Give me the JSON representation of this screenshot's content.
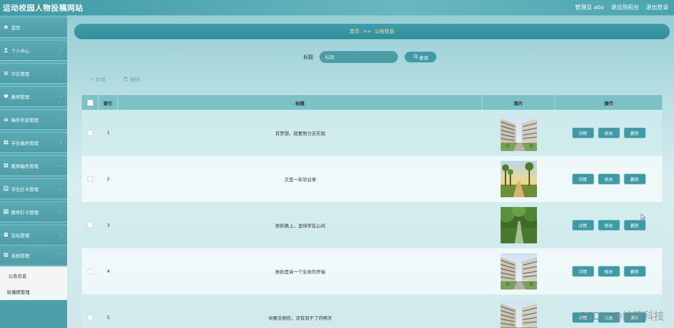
{
  "header": {
    "site_title": "运动校园人物投稿网站",
    "user_label": "管理员 abo",
    "link_front": "退出到前台",
    "link_logout": "退出登录"
  },
  "sidebar": {
    "items": [
      {
        "label": "首页",
        "icon": "home-icon"
      },
      {
        "label": "个人中心",
        "icon": "user-icon"
      },
      {
        "label": "学生管理",
        "icon": "list-icon"
      },
      {
        "label": "教师管理",
        "icon": "card-icon"
      },
      {
        "label": "稿件信息管理",
        "icon": "bar-chart-icon"
      },
      {
        "label": "学生稿件管理",
        "icon": "grid-icon"
      },
      {
        "label": "教师稿件管理",
        "icon": "grid-icon"
      },
      {
        "label": "学生打卡管理",
        "icon": "chart-icon"
      },
      {
        "label": "教师打卡管理",
        "icon": "table-icon"
      },
      {
        "label": "论坛管理",
        "icon": "forum-icon"
      },
      {
        "label": "系统管理",
        "icon": "grid-icon"
      }
    ],
    "submenu": [
      "公告信息",
      "轮播图管理"
    ]
  },
  "breadcrumb": {
    "home": "首页",
    "sep": ">>",
    "current": "公告信息"
  },
  "search": {
    "label": "标题",
    "placeholder": "标题",
    "button": "查询"
  },
  "actions": {
    "add": "新增",
    "delete": "删除"
  },
  "table": {
    "headers": {
      "index": "索引",
      "title": "标题",
      "image": "图片",
      "ops": "操作"
    },
    "row_buttons": {
      "detail": "详情",
      "edit": "修改",
      "delete": "删除"
    },
    "rows": [
      {
        "index": "1",
        "title": "有梦想，就要努力去实现",
        "image": "campus-building-photo"
      },
      {
        "index": "2",
        "title": "又是一年毕业季",
        "image": "sunset-path-photo"
      },
      {
        "index": "3",
        "title": "挫折路上，坚持常在心间",
        "image": "tree-lined-path-photo"
      },
      {
        "index": "4",
        "title": "挫折是另一个生命的开端",
        "image": "campus-building-photo"
      },
      {
        "index": "5",
        "title": "你要去相信，没有到不了的明天",
        "image": "campus-building-photo"
      }
    ]
  },
  "watermark": "CSDN @纳清科技",
  "colors": {
    "accent": "#3f9aa5",
    "breadcrumb_text": "#ffe9a0",
    "header_row": "#7cc1c8"
  }
}
